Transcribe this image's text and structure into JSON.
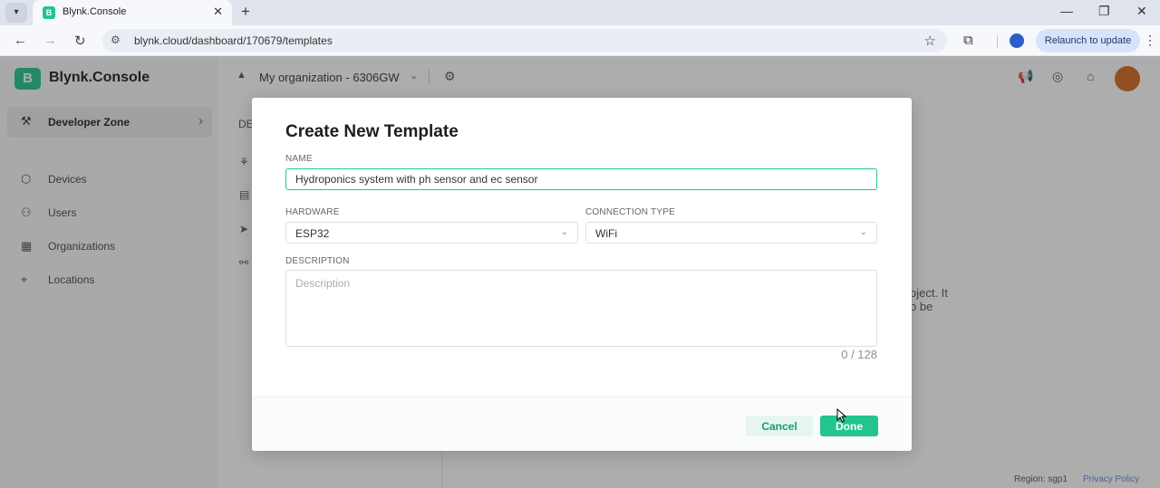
{
  "browser": {
    "tab_title": "Blynk.Console",
    "favicon_letter": "B",
    "url": "blynk.cloud/dashboard/170679/templates",
    "relaunch_label": "Relaunch to update"
  },
  "app": {
    "logo_letter": "B",
    "logo_text": "Blynk.Console",
    "brand_color": "#23c48e"
  },
  "sidebar": {
    "dev_zone_label": "Developer Zone",
    "items": [
      {
        "label": "Devices",
        "icon": "cube-icon"
      },
      {
        "label": "Users",
        "icon": "users-icon"
      },
      {
        "label": "Organizations",
        "icon": "building-icon"
      },
      {
        "label": "Locations",
        "icon": "location-pin-icon"
      }
    ]
  },
  "topbar": {
    "org_name": "My organization - 6306GW"
  },
  "background": {
    "inner_panel_heading": "DE",
    "text_line1": "oject. It",
    "text_line2": "o be",
    "region": "Region: sgp1",
    "privacy": "Privacy Policy"
  },
  "modal": {
    "title": "Create New Template",
    "name_label": "NAME",
    "name_value": "Hydroponics system with ph sensor and ec sensor",
    "hardware_label": "HARDWARE",
    "hardware_value": "ESP32",
    "connection_label": "CONNECTION TYPE",
    "connection_value": "WiFi",
    "description_label": "DESCRIPTION",
    "description_placeholder": "Description",
    "counter": "0 / 128",
    "cancel_label": "Cancel",
    "done_label": "Done"
  }
}
